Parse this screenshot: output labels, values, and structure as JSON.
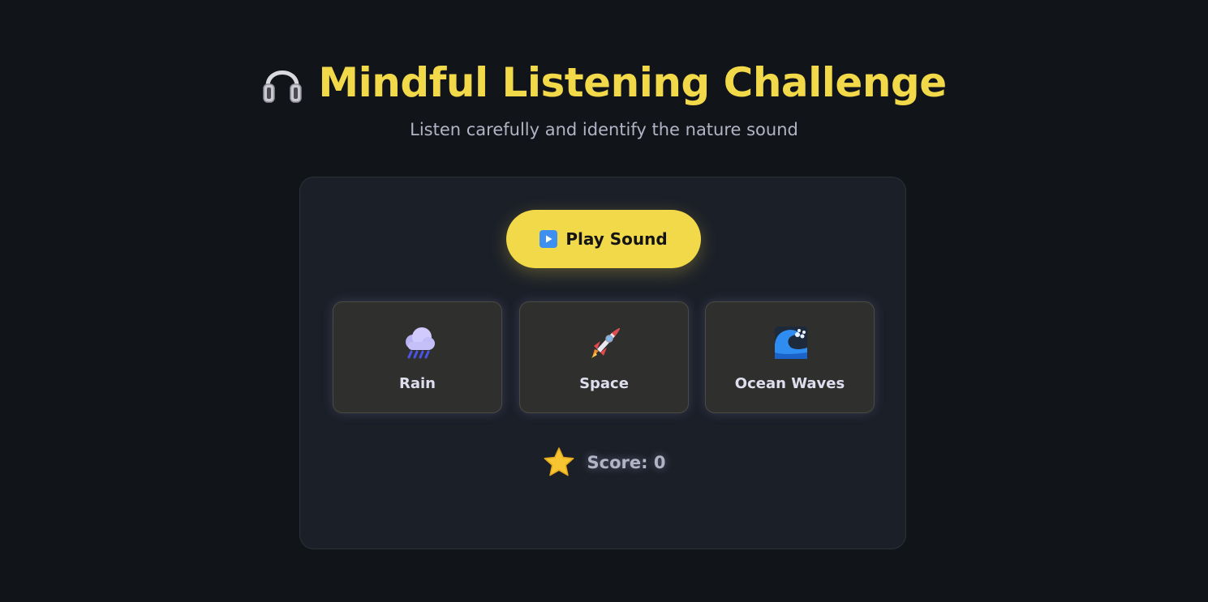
{
  "header": {
    "title": "Mindful Listening Challenge",
    "title_icon": "headphones-icon",
    "subtitle": "Listen carefully and identify the nature sound"
  },
  "player": {
    "play_label": "Play Sound",
    "play_icon": "play-icon"
  },
  "options": [
    {
      "label": "Rain",
      "icon": "rain-cloud-icon"
    },
    {
      "label": "Space",
      "icon": "rocket-icon"
    },
    {
      "label": "Ocean Waves",
      "icon": "wave-icon"
    }
  ],
  "score": {
    "text": "Score: 0",
    "icon": "star-icon"
  },
  "colors": {
    "background": "#111418",
    "card": "#1b1f28",
    "accent": "#f2d94a",
    "muted_text": "#b3b3c6",
    "option_bg": "#2f2f2d"
  }
}
